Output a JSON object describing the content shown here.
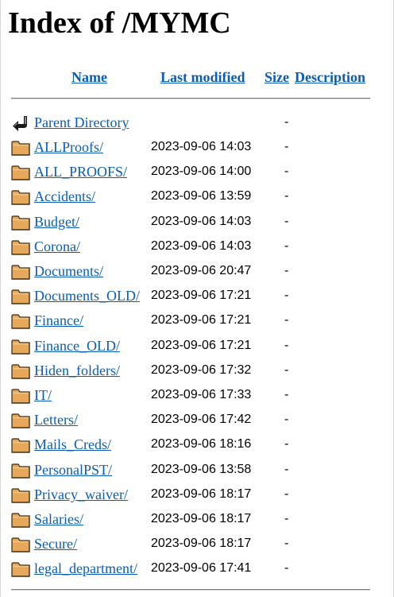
{
  "page": {
    "title": "Index of /MYMC"
  },
  "table": {
    "headers": {
      "name": "Name",
      "last_modified": "Last modified",
      "size": "Size",
      "description": "Description"
    },
    "parent": {
      "name": "Parent Directory",
      "date": "",
      "size": "-",
      "icon": "back-arrow-icon"
    },
    "rows": [
      {
        "name": "ALLProofs/",
        "date": "2023-09-06 14:03",
        "size": "-",
        "icon": "folder-icon"
      },
      {
        "name": "ALL_PROOFS/",
        "date": "2023-09-06 14:00",
        "size": "-",
        "icon": "folder-icon"
      },
      {
        "name": "Accidents/",
        "date": "2023-09-06 13:59",
        "size": "-",
        "icon": "folder-icon"
      },
      {
        "name": "Budget/",
        "date": "2023-09-06 14:03",
        "size": "-",
        "icon": "folder-icon"
      },
      {
        "name": "Corona/",
        "date": "2023-09-06 14:03",
        "size": "-",
        "icon": "folder-icon"
      },
      {
        "name": "Documents/",
        "date": "2023-09-06 20:47",
        "size": "-",
        "icon": "folder-icon"
      },
      {
        "name": "Documents_OLD/",
        "date": "2023-09-06 17:21",
        "size": "-",
        "icon": "folder-icon"
      },
      {
        "name": "Finance/",
        "date": "2023-09-06 17:21",
        "size": "-",
        "icon": "folder-icon"
      },
      {
        "name": "Finance_OLD/",
        "date": "2023-09-06 17:21",
        "size": "-",
        "icon": "folder-icon"
      },
      {
        "name": "Hiden_folders/",
        "date": "2023-09-06 17:32",
        "size": "-",
        "icon": "folder-icon"
      },
      {
        "name": "IT/",
        "date": "2023-09-06 17:33",
        "size": "-",
        "icon": "folder-icon"
      },
      {
        "name": "Letters/",
        "date": "2023-09-06 17:42",
        "size": "-",
        "icon": "folder-icon"
      },
      {
        "name": "Mails_Creds/",
        "date": "2023-09-06 18:16",
        "size": "-",
        "icon": "folder-icon"
      },
      {
        "name": "PersonalPST/",
        "date": "2023-09-06 13:58",
        "size": "-",
        "icon": "folder-icon"
      },
      {
        "name": "Privacy_waiver/",
        "date": "2023-09-06 18:17",
        "size": "-",
        "icon": "folder-icon"
      },
      {
        "name": "Salaries/",
        "date": "2023-09-06 18:17",
        "size": "-",
        "icon": "folder-icon"
      },
      {
        "name": "Secure/",
        "date": "2023-09-06 18:17",
        "size": "-",
        "icon": "folder-icon"
      },
      {
        "name": "legal_department/",
        "date": "2023-09-06 17:41",
        "size": "-",
        "icon": "folder-icon"
      }
    ]
  },
  "colors": {
    "link": "#0a5db0",
    "folder_fill": "#e8a85c",
    "folder_tab": "#f2c98b",
    "folder_outline": "#3a2a10"
  }
}
